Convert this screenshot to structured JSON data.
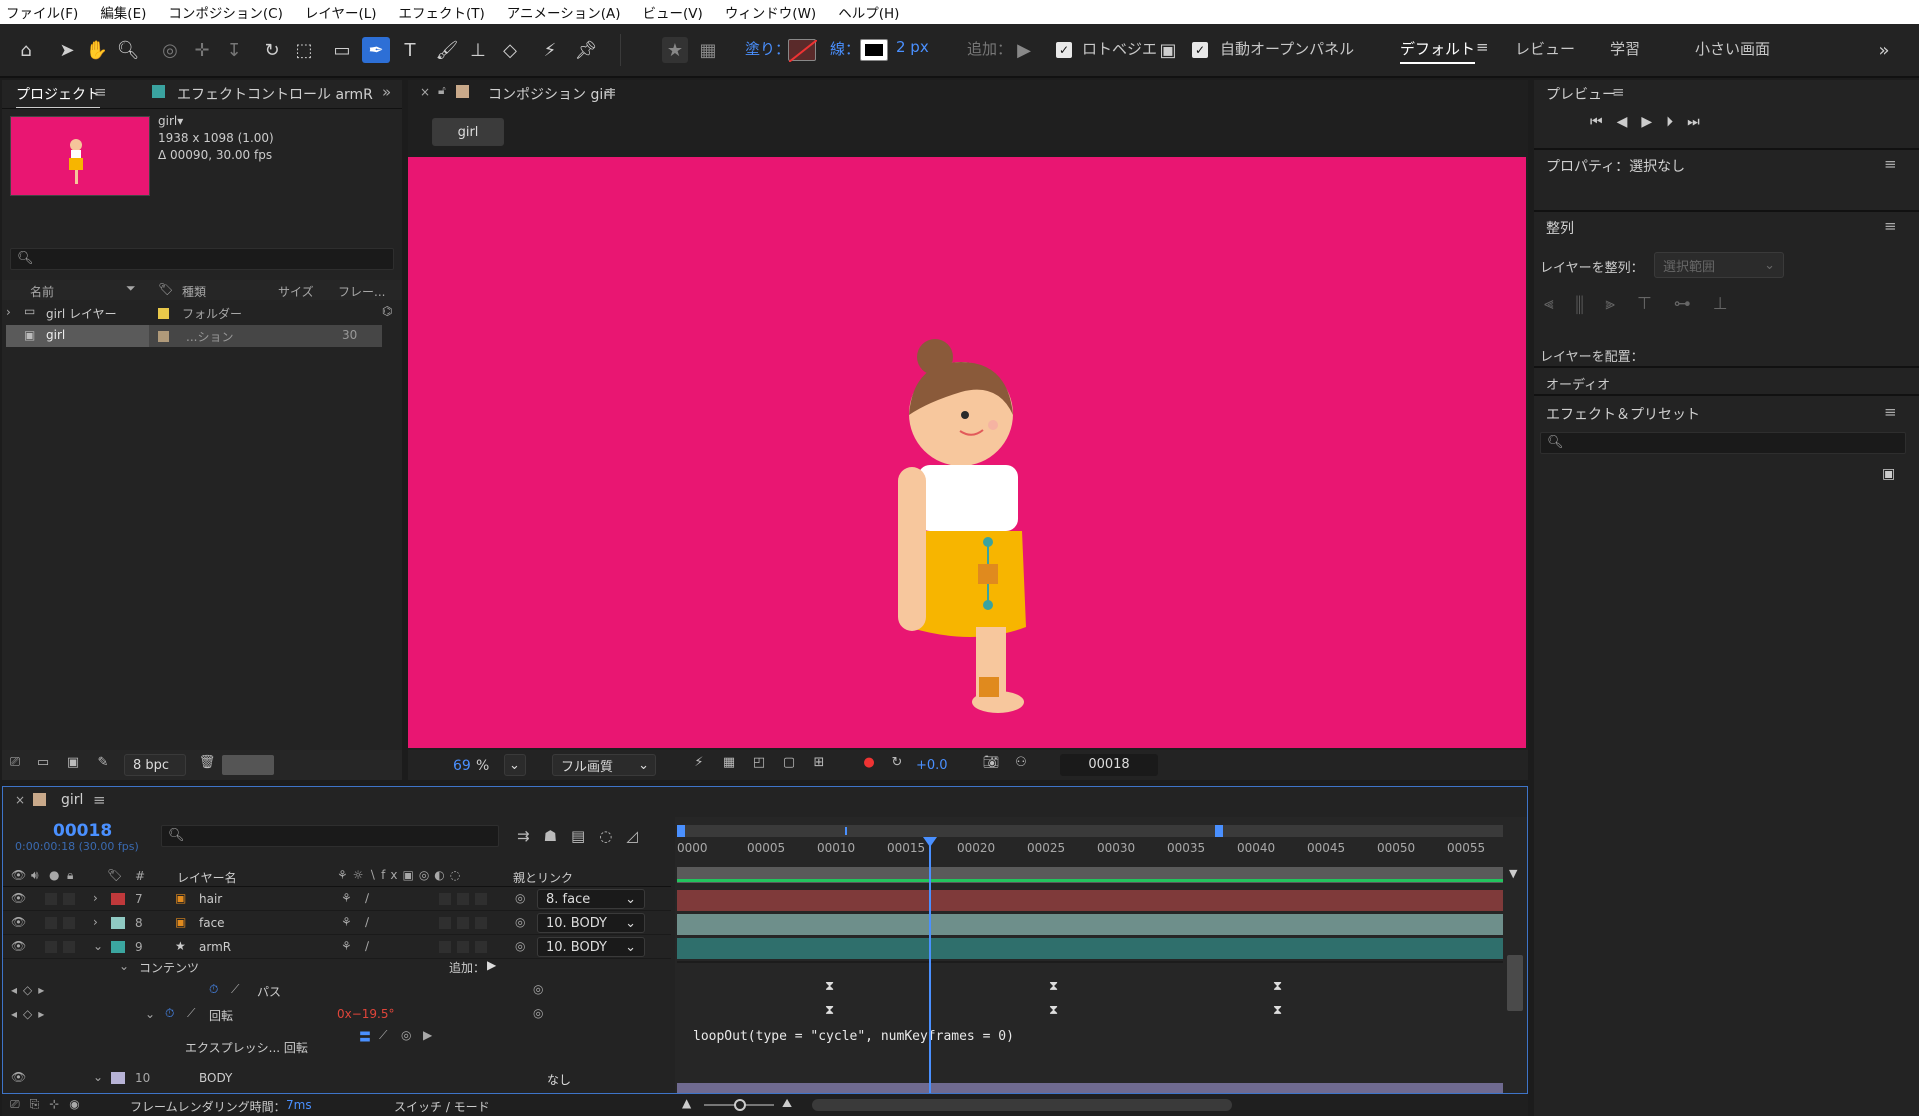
{
  "menu": [
    "ファイル(F)",
    "編集(E)",
    "コンポジション(C)",
    "レイヤー(L)",
    "エフェクト(T)",
    "アニメーション(A)",
    "ビュー(V)",
    "ウィンドウ(W)",
    "ヘルプ(H)"
  ],
  "toolbar": {
    "fill_label": "塗り：",
    "stroke_label": "線：",
    "stroke_width": "2 px",
    "add_label": "追加：",
    "rotobezier": "ロトベジエ",
    "auto_open_panel": "自動オープンパネル",
    "workspaces": [
      "デフォルト",
      "レビュー",
      "学習",
      "小さい画面"
    ]
  },
  "project": {
    "tab_project": "プロジェクト",
    "tab_effect_controls": "エフェクトコントロール armR",
    "comp_name": "girl▾",
    "comp_size": "1938 x 1098 (1.00)",
    "comp_duration": "Δ 00090, 30.00 fps",
    "columns": [
      "名前",
      "種類",
      "サイズ",
      "フレー..."
    ],
    "items": [
      {
        "name": "girl レイヤー",
        "type": "フォルダー",
        "size": "",
        "frames": "",
        "color": "#e8c84a"
      },
      {
        "name": "girl",
        "type": "...ション",
        "size": "",
        "frames": "30",
        "color": "#b09a7a"
      }
    ],
    "bpc": "8 bpc"
  },
  "composition": {
    "tab": "コンポジション girl",
    "breadcrumb": "girl",
    "bg_color": "#e91672",
    "zoom": "69",
    "zoom_unit": "%",
    "quality": "フル画質",
    "exposure": "+0.0",
    "timecode": "00018"
  },
  "right": {
    "preview_title": "プレビュー",
    "properties_title": "プロパティ：選択なし",
    "align_title": "整列",
    "align_layers_to": "レイヤーを整列：",
    "align_target": "選択範囲",
    "distribute_layers": "レイヤーを配置：",
    "audio": "オーディオ",
    "effects_presets": "エフェクト＆プリセット"
  },
  "timeline": {
    "tab": "girl",
    "current_time": "00018",
    "current_time_sub": "0:00:00:18 (30.00 fps)",
    "col_layer_name": "レイヤー名",
    "col_parent": "親とリンク",
    "col_hash": "#",
    "ruler": [
      "0000",
      "00005",
      "00010",
      "00015",
      "00020",
      "00025",
      "00030",
      "00035",
      "00040",
      "00045",
      "00050",
      "00055"
    ],
    "current_frame": 18,
    "layers": [
      {
        "num": "7",
        "name": "hair",
        "color": "#c0393b",
        "parent": "8. face"
      },
      {
        "num": "8",
        "name": "face",
        "color": "#8fc9c2",
        "parent": "10. BODY"
      },
      {
        "num": "9",
        "name": "armR",
        "color": "#3ba6a0",
        "parent": "10. BODY"
      }
    ],
    "contents": "コンテンツ",
    "add": "追加：",
    "path": "パス",
    "rotation": "回転",
    "rotation_value": "0x−19.5°",
    "expression_label": "エクスプレッシ... 回転",
    "expression": "loopOut(type = \"cycle\", numKeyframes = 0)",
    "body_layer": {
      "num": "10",
      "name": "BODY",
      "parent": "なし"
    },
    "keyframes": [
      11,
      27,
      43
    ],
    "render_time_label": "フレームレンダリング時間：",
    "render_time": "7ms",
    "switch_mode": "スイッチ / モード"
  }
}
